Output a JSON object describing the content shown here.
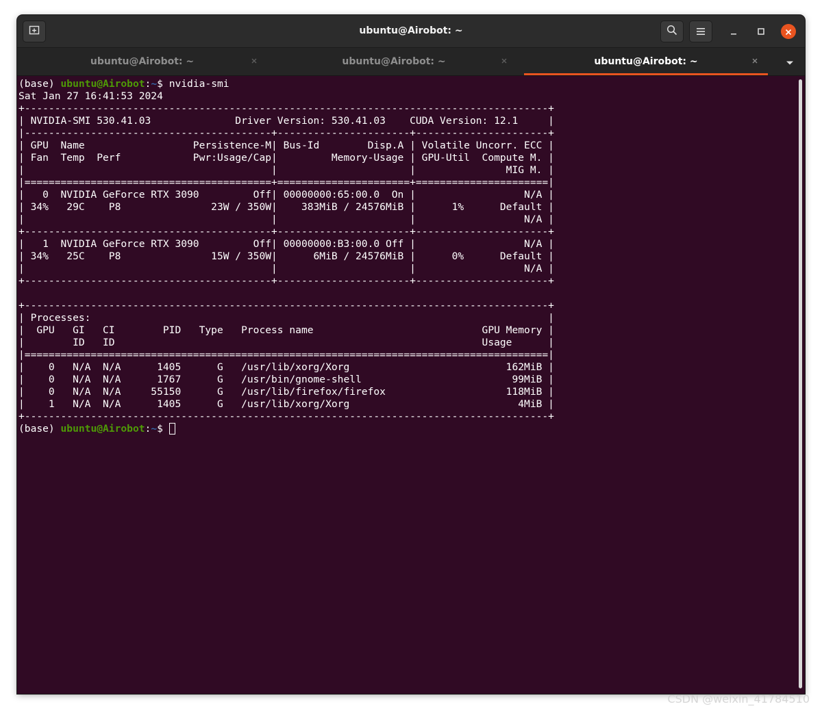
{
  "window": {
    "title": "ubuntu@Airobot: ~"
  },
  "tabs": [
    {
      "label": "ubuntu@Airobot: ~",
      "active": false
    },
    {
      "label": "ubuntu@Airobot: ~",
      "active": false
    },
    {
      "label": "ubuntu@Airobot: ~",
      "active": true
    }
  ],
  "icons": {
    "new_tab": "new-tab-icon",
    "search": "search-icon",
    "menu": "hamburger-menu-icon",
    "minimize": "minimize-icon",
    "maximize": "maximize-icon",
    "close": "close-icon",
    "tab_close": "close-icon",
    "tab_dropdown": "chevron-down-icon"
  },
  "colors": {
    "terminal_bg": "#300a24",
    "prompt_user": "#4e9a06",
    "prompt_path": "#3465a4",
    "accent": "#e95420"
  },
  "terminal": {
    "prompt1": {
      "env": "(base) ",
      "user": "ubuntu@Airobot",
      "sep": ":",
      "path": "~",
      "symbol": "$ ",
      "command": "nvidia-smi"
    },
    "output_lines": [
      "Sat Jan 27 16:41:53 2024       ",
      "+---------------------------------------------------------------------------------------+",
      "| NVIDIA-SMI 530.41.03              Driver Version: 530.41.03    CUDA Version: 12.1     |",
      "|-----------------------------------------+----------------------+----------------------+",
      "| GPU  Name                  Persistence-M| Bus-Id        Disp.A | Volatile Uncorr. ECC |",
      "| Fan  Temp  Perf            Pwr:Usage/Cap|         Memory-Usage | GPU-Util  Compute M. |",
      "|                                         |                      |               MIG M. |",
      "|=========================================+======================+======================|",
      "|   0  NVIDIA GeForce RTX 3090         Off| 00000000:65:00.0  On |                  N/A |",
      "| 34%   29C    P8               23W / 350W|    383MiB / 24576MiB |      1%      Default |",
      "|                                         |                      |                  N/A |",
      "+-----------------------------------------+----------------------+----------------------+",
      "|   1  NVIDIA GeForce RTX 3090         Off| 00000000:B3:00.0 Off |                  N/A |",
      "| 34%   25C    P8               15W / 350W|      6MiB / 24576MiB |      0%      Default |",
      "|                                         |                      |                  N/A |",
      "+-----------------------------------------+----------------------+----------------------+",
      "",
      "+---------------------------------------------------------------------------------------+",
      "| Processes:                                                                            |",
      "|  GPU   GI   CI        PID   Type   Process name                            GPU Memory |",
      "|        ID   ID                                                             Usage      |",
      "|=======================================================================================|",
      "|    0   N/A  N/A      1405      G   /usr/lib/xorg/Xorg                          162MiB |",
      "|    0   N/A  N/A      1767      G   /usr/bin/gnome-shell                         99MiB |",
      "|    0   N/A  N/A     55150      G   /usr/lib/firefox/firefox                    118MiB |",
      "|    1   N/A  N/A      1405      G   /usr/lib/xorg/Xorg                            4MiB |",
      "+---------------------------------------------------------------------------------------+"
    ],
    "prompt2": {
      "env": "(base) ",
      "user": "ubuntu@Airobot",
      "sep": ":",
      "path": "~",
      "symbol": "$ "
    }
  },
  "watermark": "CSDN @weixin_41784510"
}
